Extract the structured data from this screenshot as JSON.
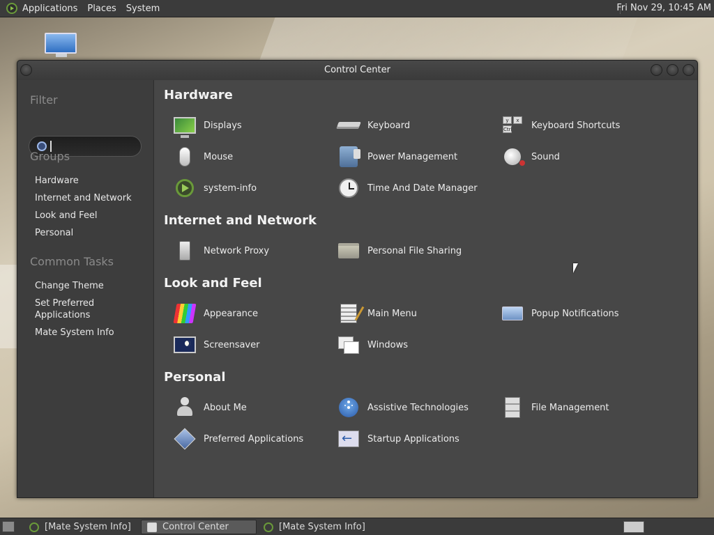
{
  "top_panel": {
    "menus": [
      "Applications",
      "Places",
      "System"
    ],
    "clock": "Fri Nov 29, 10:45 AM"
  },
  "window": {
    "title": "Control Center"
  },
  "sidebar": {
    "filter_heading": "Filter",
    "search_value": "",
    "groups_heading": "Groups",
    "groups": [
      "Hardware",
      "Internet and Network",
      "Look and Feel",
      "Personal"
    ],
    "tasks_heading": "Common Tasks",
    "tasks": [
      "Change Theme",
      "Set Preferred\nApplications",
      "Mate System Info"
    ]
  },
  "categories": [
    {
      "title": "Hardware",
      "items": [
        {
          "label": "Displays",
          "icon": "displays-icon"
        },
        {
          "label": "Keyboard",
          "icon": "keyboard-icon"
        },
        {
          "label": "Keyboard Shortcuts",
          "icon": "keyboard-shortcuts-icon"
        },
        {
          "label": "Mouse",
          "icon": "mouse-icon"
        },
        {
          "label": "Power Management",
          "icon": "power-management-icon"
        },
        {
          "label": "Sound",
          "icon": "sound-icon"
        },
        {
          "label": "system-info",
          "icon": "system-info-icon"
        },
        {
          "label": "Time And Date Manager",
          "icon": "clock-icon"
        }
      ]
    },
    {
      "title": "Internet and Network",
      "items": [
        {
          "label": "Network Proxy",
          "icon": "network-proxy-icon"
        },
        {
          "label": "Personal File Sharing",
          "icon": "folder-icon"
        }
      ]
    },
    {
      "title": "Look and Feel",
      "items": [
        {
          "label": "Appearance",
          "icon": "appearance-icon"
        },
        {
          "label": "Main Menu",
          "icon": "main-menu-icon"
        },
        {
          "label": "Popup Notifications",
          "icon": "popup-notifications-icon"
        },
        {
          "label": "Screensaver",
          "icon": "screensaver-icon"
        },
        {
          "label": "Windows",
          "icon": "windows-icon"
        }
      ]
    },
    {
      "title": "Personal",
      "items": [
        {
          "label": "About Me",
          "icon": "about-me-icon"
        },
        {
          "label": "Assistive Technologies",
          "icon": "accessibility-icon"
        },
        {
          "label": "File Management",
          "icon": "file-management-icon"
        },
        {
          "label": "Preferred Applications",
          "icon": "preferred-applications-icon"
        },
        {
          "label": "Startup Applications",
          "icon": "startup-applications-icon"
        }
      ]
    }
  ],
  "taskbar": {
    "tasks": [
      "[Mate System Info]",
      "Control Center",
      "[Mate System Info]"
    ]
  },
  "colors": {
    "panel": "#3b3b3b",
    "sidebar": "#3d3d3d",
    "content": "#474747",
    "heading_muted": "#8a8a8a"
  }
}
